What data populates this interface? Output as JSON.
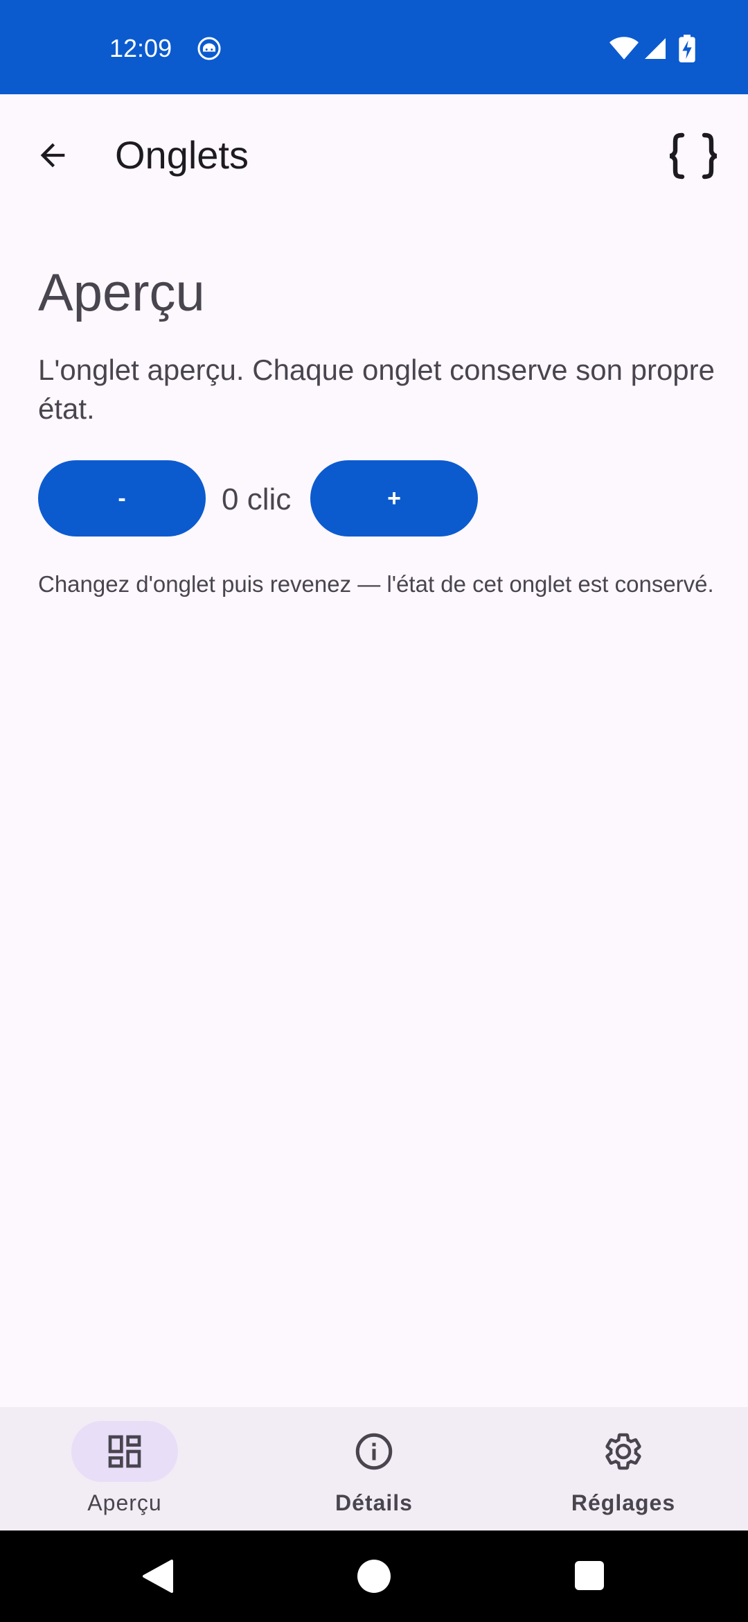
{
  "status_bar": {
    "time": "12:09",
    "background": "#0b5bcf"
  },
  "app_bar": {
    "title": "Onglets",
    "back_icon": "arrow-back-icon",
    "action_icon": "code-braces-icon"
  },
  "content": {
    "section_title": "Aperçu",
    "description": "L'onglet aperçu. Chaque onglet conserve son propre état.",
    "decrement_label": "-",
    "count_label": "0 clic",
    "increment_label": "+",
    "hint": "Changez d'onglet puis revenez — l'état de cet onglet est conservé."
  },
  "bottom_nav": {
    "items": [
      {
        "label": "Aperçu",
        "icon": "dashboard-icon",
        "active": true
      },
      {
        "label": "Détails",
        "icon": "info-icon",
        "active": false
      },
      {
        "label": "Réglages",
        "icon": "gear-icon",
        "active": false
      }
    ]
  },
  "colors": {
    "primary": "#0b5bcf",
    "background": "#fdf7fe",
    "nav_background": "#f2ecf4",
    "active_indicator": "#e8def8"
  }
}
